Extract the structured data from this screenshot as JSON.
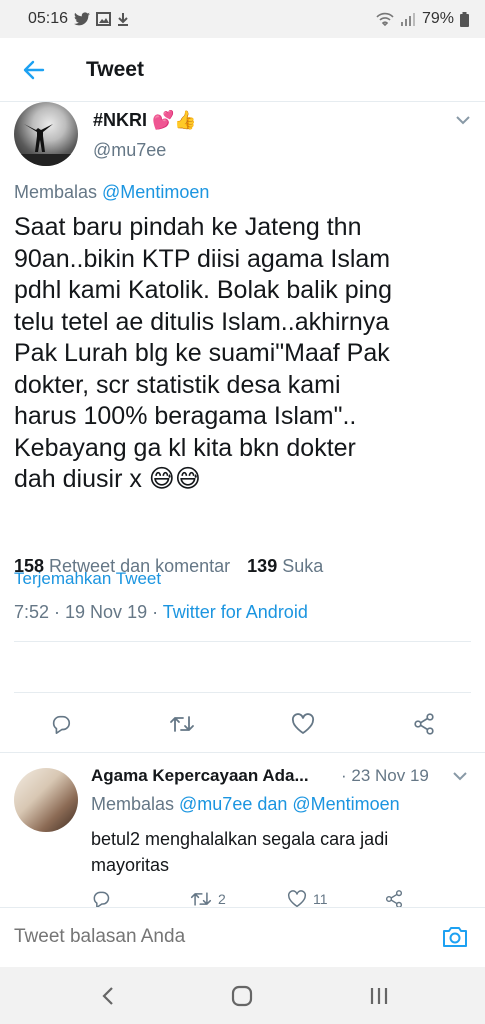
{
  "status_bar": {
    "time": "05:16",
    "battery": "79%"
  },
  "header": {
    "title": "Tweet"
  },
  "tweet": {
    "display_name": "#NKRI 💕👍",
    "handle": "@mu7ee",
    "reply_prefix": "Membalas ",
    "reply_mention": "@Mentimoen",
    "text": "Saat baru pindah ke Jateng thn\n90an..bikin KTP diisi agama Islam\npdhl kami Katolik. Bolak balik ping\ntelu tetel ae ditulis Islam..akhirnya\nPak Lurah blg ke suami\"Maaf Pak\ndokter, scr statistik desa kami\nharus 100% beragama Islam\"..\nKebayang ga kl kita bkn dokter\ndah diusir x 😅😅",
    "translate_label": "Terjemahkan Tweet",
    "time_date": "7:52 · 19 Nov 19 · ",
    "source": "Twitter for Android",
    "retweet_count": "158",
    "retweet_label": " Retweet dan komentar",
    "like_count": "139",
    "like_label": " Suka"
  },
  "reply": {
    "display_name": "Agama Kepercayaan Ada...",
    "date": "· 23 Nov 19",
    "reply_prefix": "Membalas ",
    "reply_mentions": "@mu7ee dan @Mentimoen",
    "text": "betul2 menghalalkan segala cara jadi mayoritas",
    "retweet_count": "2",
    "like_count": "11"
  },
  "compose": {
    "placeholder": "Tweet balasan Anda"
  }
}
